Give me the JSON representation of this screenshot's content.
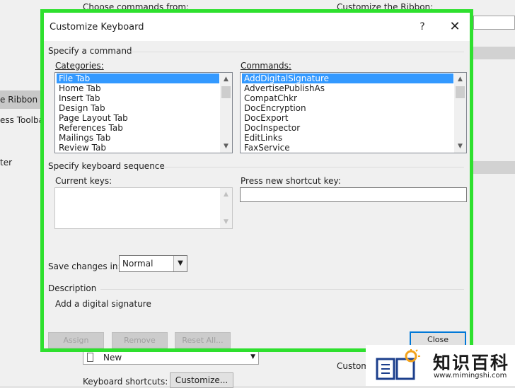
{
  "background": {
    "choose_commands_from": "Choose commands from:",
    "customize_the_ribbon": "Customize the Ribbon:",
    "sidebar_ribbon": "e Ribbon",
    "sidebar_toolbar": "ess Toolbar",
    "sidebar_center": "ter",
    "combo_new_value": "New",
    "customize_partial": "Custom",
    "keyboard_shortcuts_label": "Keyboard shortcuts:",
    "customize_button": "Customize..."
  },
  "dialog": {
    "title": "Customize Keyboard",
    "help_icon": "?",
    "close_icon": "✕",
    "specify_command_label": "Specify a command",
    "categories_label": "Categories:",
    "categories": [
      "File Tab",
      "Home Tab",
      "Insert Tab",
      "Design Tab",
      "Page Layout Tab",
      "References Tab",
      "Mailings Tab",
      "Review Tab"
    ],
    "selected_category_index": 0,
    "commands_label": "Commands:",
    "commands": [
      "AddDigitalSignature",
      "AdvertisePublishAs",
      "CompatChkr",
      "DocEncryption",
      "DocExport",
      "DocInspector",
      "EditLinks",
      "FaxService"
    ],
    "selected_command_index": 0,
    "specify_sequence_label": "Specify keyboard sequence",
    "current_keys_label": "Current keys:",
    "new_shortcut_label": "Press new shortcut key:",
    "new_shortcut_value": "",
    "save_changes_label": "Save changes in:",
    "save_changes_value": "Normal",
    "description_label": "Description",
    "description_text": "Add a digital signature",
    "assign_button": "Assign",
    "remove_button": "Remove",
    "reset_all_button": "Reset All...",
    "close_button": "Close"
  },
  "watermark": {
    "name": "知识百科",
    "url": "www.mimingshi.com"
  },
  "colors": {
    "highlight_border": "#2ee02e",
    "selection": "#3399ff",
    "focus_border": "#0078d7"
  }
}
